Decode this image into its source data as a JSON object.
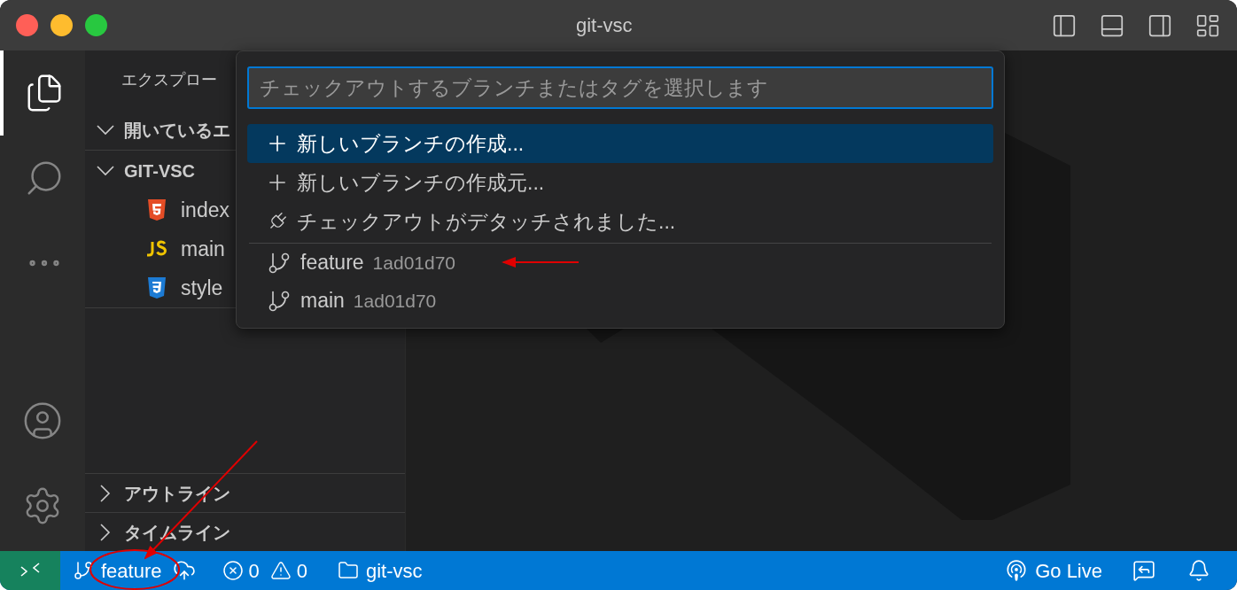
{
  "window": {
    "title": "git-vsc"
  },
  "activity_bar": [
    {
      "kind": "explorer",
      "selected": true
    },
    {
      "kind": "search",
      "selected": false
    },
    {
      "kind": "more",
      "selected": false
    }
  ],
  "activity_bottom": [
    {
      "kind": "account"
    },
    {
      "kind": "settings"
    }
  ],
  "sidebar": {
    "title": "エクスプロー",
    "sections": [
      {
        "label": "開いているエ",
        "expanded": true
      },
      {
        "label": "GIT-VSC",
        "expanded": true,
        "files": [
          {
            "name": "index",
            "kind": "html"
          },
          {
            "name": "main",
            "kind": "js"
          },
          {
            "name": "style",
            "kind": "css"
          }
        ]
      }
    ],
    "bottom_sections": [
      {
        "label": "アウトライン",
        "expanded": false
      },
      {
        "label": "タイムライン",
        "expanded": false
      }
    ]
  },
  "quick_pick": {
    "placeholder": "チェックアウトするブランチまたはタグを選択します",
    "actions": [
      {
        "kind": "create",
        "label": "新しいブランチの作成...",
        "selected": true
      },
      {
        "kind": "create",
        "label": "新しいブランチの作成元...",
        "selected": false
      },
      {
        "kind": "detach",
        "label": "チェックアウトがデタッチされました...",
        "selected": false
      }
    ],
    "branches": [
      {
        "name": "feature",
        "hash": "1ad01d70",
        "selected": false
      },
      {
        "name": "main",
        "hash": "1ad01d70",
        "selected": false
      }
    ]
  },
  "status_bar": {
    "branch": "feature",
    "errors": "0",
    "warnings": "0",
    "folder": "git-vsc",
    "go_live": "Go Live"
  }
}
